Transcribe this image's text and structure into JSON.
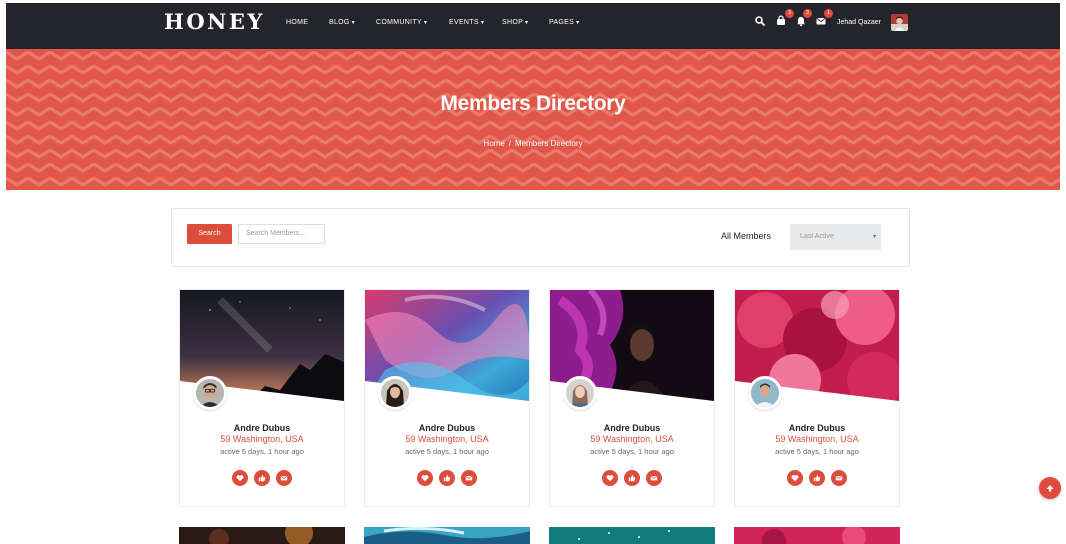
{
  "brand": {
    "logo": "HONEY"
  },
  "nav": {
    "items": [
      {
        "label": "HOME",
        "has_dropdown": false
      },
      {
        "label": "BLOG",
        "has_dropdown": true
      },
      {
        "label": "COMMUNITY",
        "has_dropdown": true
      },
      {
        "label": "EVENTS",
        "has_dropdown": true
      },
      {
        "label": "SHOP",
        "has_dropdown": true
      },
      {
        "label": "PAGES",
        "has_dropdown": true
      }
    ],
    "caret": "▾",
    "icons": [
      "search-icon",
      "cart-icon",
      "bell-icon",
      "envelope-icon"
    ],
    "badges": {
      "cart": "3",
      "notifications": "3",
      "messages": "1"
    },
    "user": {
      "name": "Jehad Qazaer"
    }
  },
  "hero": {
    "title": "Members Directory",
    "breadcrumb": {
      "home": "Home",
      "separator": "/",
      "current": "Members Directory"
    }
  },
  "toolbar": {
    "search_label": "Search",
    "search_placeholder": "Search Members...",
    "filter_label": "All Members",
    "sort_value": "Last Active",
    "sort_chevron": "▾"
  },
  "members": [
    {
      "name": "Andre Dubus",
      "location": "59 Washington, USA",
      "activity": "active 5 days, 1 hour ago",
      "cover": "night-mountain"
    },
    {
      "name": "Andre Dubus",
      "location": "59 Washington, USA",
      "activity": "active 5 days, 1 hour ago",
      "cover": "pink-blue-smoke"
    },
    {
      "name": "Andre Dubus",
      "location": "59 Washington, USA",
      "activity": "active 5 days, 1 hour ago",
      "cover": "purple-smoke-portrait"
    },
    {
      "name": "Andre Dubus",
      "location": "59 Washington, USA",
      "activity": "active 5 days, 1 hour ago",
      "cover": "pink-smoke"
    }
  ],
  "member_actions": [
    "heart-icon",
    "thumbs-up-icon",
    "envelope-icon"
  ],
  "colors": {
    "accent": "#dc4d3b",
    "nav_bg": "#24252a",
    "hero_bg": "#e0574a"
  }
}
